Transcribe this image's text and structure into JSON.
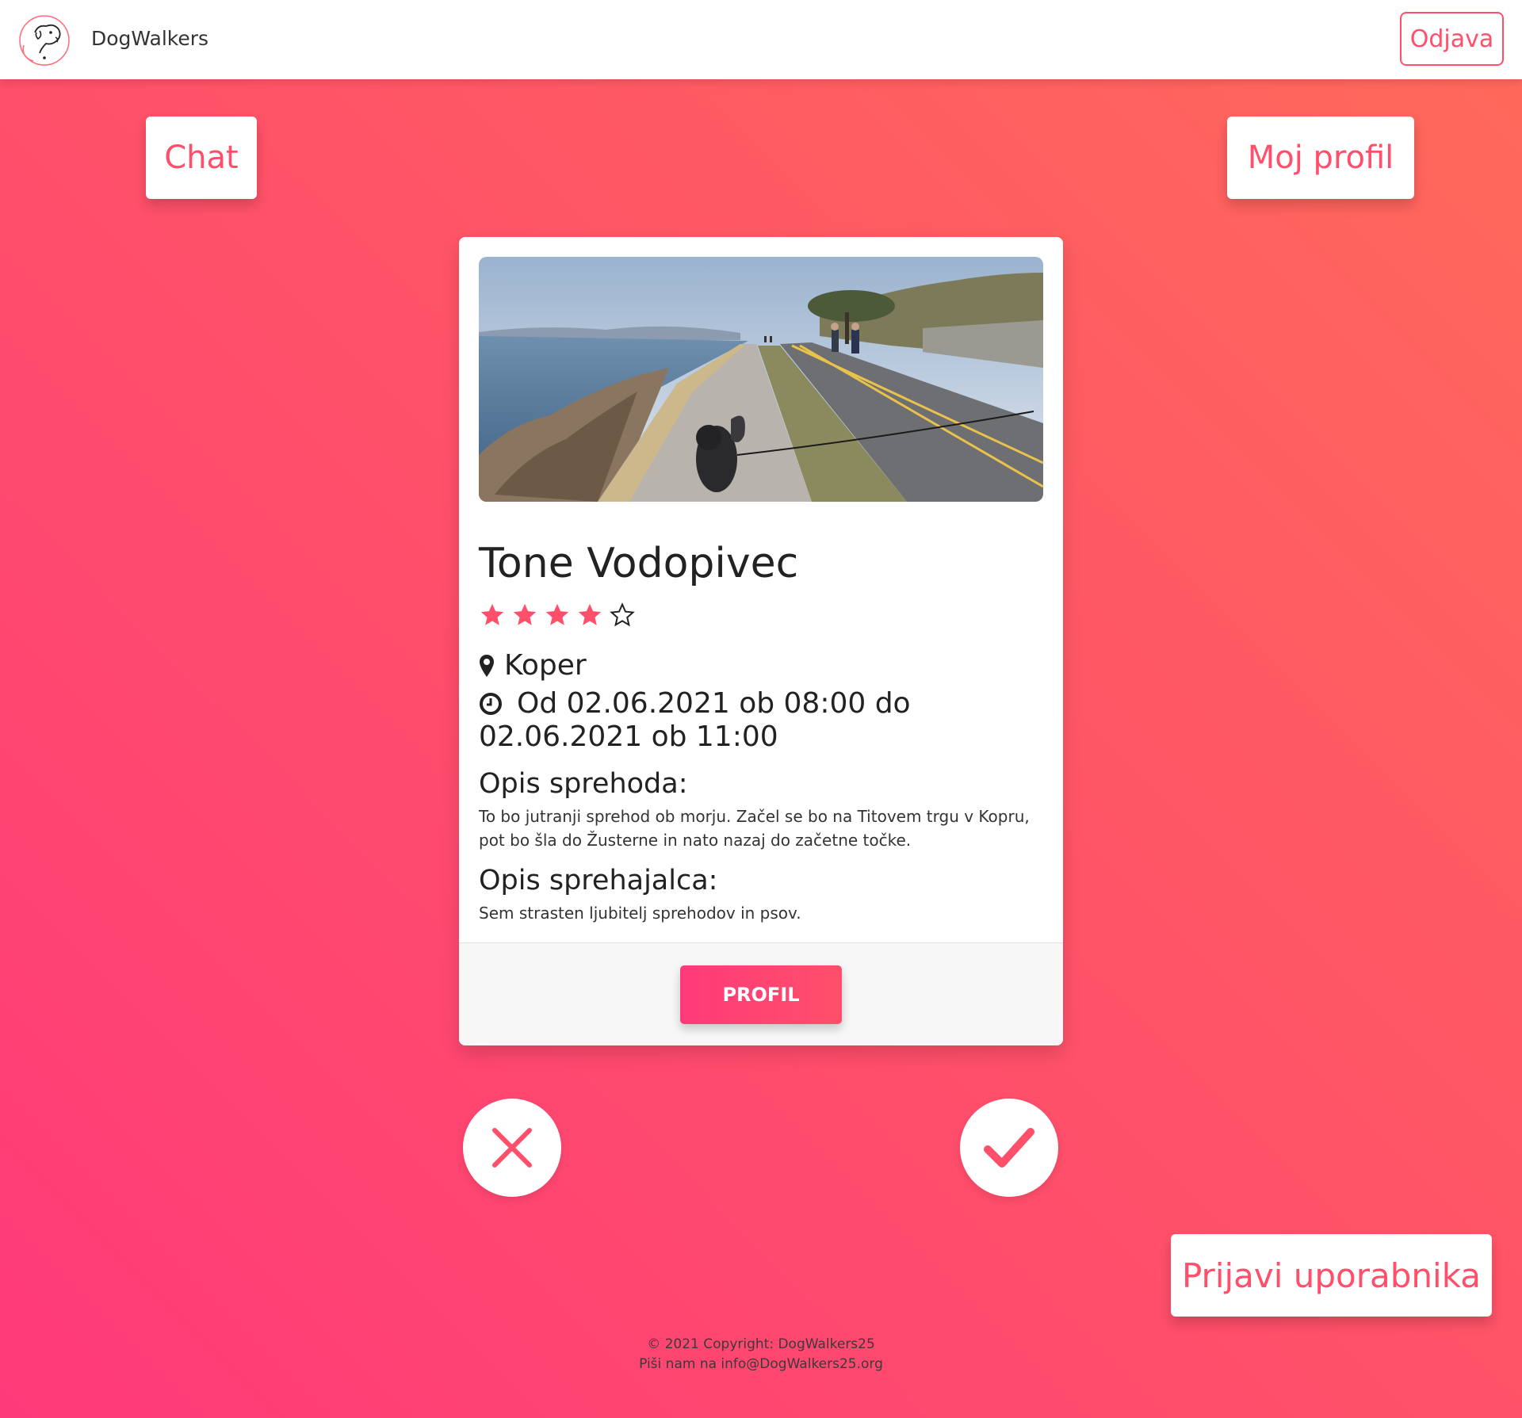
{
  "navbar": {
    "brand": "DogWalkers",
    "logout_label": "Odjava",
    "logo_icon": "dog-logo-icon"
  },
  "actions": {
    "chat_label": "Chat",
    "my_profile_label": "Moj profil",
    "report_label": "Prijavi uporabnika"
  },
  "card": {
    "name": "Tone Vodopivec",
    "rating": 4,
    "rating_max": 5,
    "location": "Koper",
    "time": "Od 02.06.2021 ob 08:00 do 02.06.2021 ob 11:00",
    "walk_heading": "Opis sprehoda:",
    "walk_description": "To bo jutranji sprehod ob morju. Začel se bo na Titovem trgu v Kopru, pot bo šla do Žusterne in nato nazaj do začetne točke.",
    "walker_heading": "Opis sprehajalca:",
    "walker_description": "Sem strasten ljubitelj sprehodov in psov.",
    "profile_button": "PROFIL"
  },
  "swipe": {
    "reject_icon": "close-icon",
    "accept_icon": "check-icon"
  },
  "footer": {
    "copyright": "© 2021 Copyright: DogWalkers25",
    "contact": "Piši nam na info@DogWalkers25.org"
  },
  "colors": {
    "accent": "#ff4f6a",
    "gradient_start": "#ff3a7a",
    "gradient_end": "#ff6a5a"
  }
}
